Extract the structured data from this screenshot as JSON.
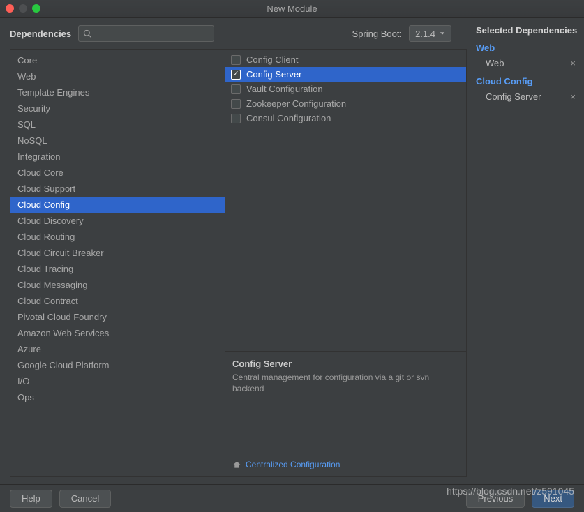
{
  "title": "New Module",
  "toolbar": {
    "dependencies_label": "Dependencies",
    "springboot_label": "Spring Boot:",
    "springboot_version": "2.1.4"
  },
  "categories": [
    "Core",
    "Web",
    "Template Engines",
    "Security",
    "SQL",
    "NoSQL",
    "Integration",
    "Cloud Core",
    "Cloud Support",
    "Cloud Config",
    "Cloud Discovery",
    "Cloud Routing",
    "Cloud Circuit Breaker",
    "Cloud Tracing",
    "Cloud Messaging",
    "Cloud Contract",
    "Pivotal Cloud Foundry",
    "Amazon Web Services",
    "Azure",
    "Google Cloud Platform",
    "I/O",
    "Ops"
  ],
  "selected_category_index": 9,
  "dependencies": [
    {
      "label": "Config Client",
      "checked": false,
      "selected": false
    },
    {
      "label": "Config Server",
      "checked": true,
      "selected": true
    },
    {
      "label": "Vault Configuration",
      "checked": false,
      "selected": false
    },
    {
      "label": "Zookeeper Configuration",
      "checked": false,
      "selected": false
    },
    {
      "label": "Consul Configuration",
      "checked": false,
      "selected": false
    }
  ],
  "description": {
    "title": "Config Server",
    "text": "Central management for configuration via a git or svn backend",
    "link_label": "Centralized Configuration"
  },
  "selected_panel": {
    "title": "Selected Dependencies",
    "groups": [
      {
        "title": "Web",
        "items": [
          "Web"
        ]
      },
      {
        "title": "Cloud Config",
        "items": [
          "Config Server"
        ]
      }
    ]
  },
  "buttons": {
    "help": "Help",
    "cancel": "Cancel",
    "previous": "Previous",
    "next": "Next"
  },
  "watermark": "https://blog.csdn.net/z591045"
}
